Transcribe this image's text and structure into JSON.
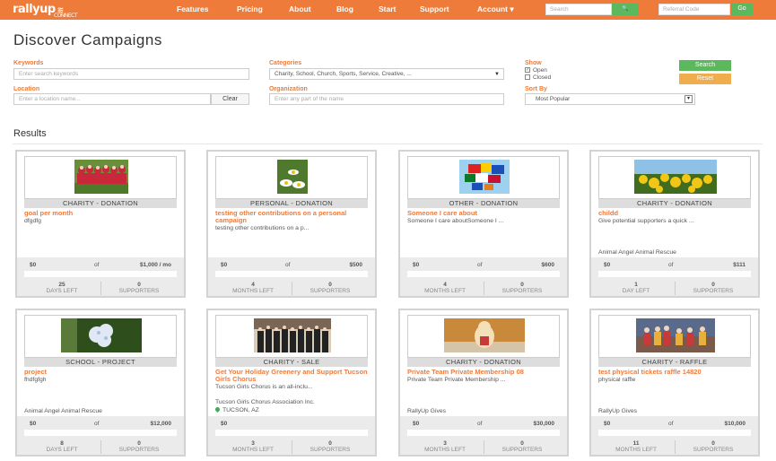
{
  "header": {
    "logo": "rallyup",
    "logo_small": "CONNECT",
    "nav": [
      "Features",
      "Pricing",
      "About",
      "Blog",
      "Start",
      "Support",
      "Account ▾"
    ],
    "search_placeholder": "Search",
    "search_button": "🔍",
    "referral_placeholder": "Referral Code",
    "go_label": "Go",
    "accent": "#ef7b3a"
  },
  "page_title": "Discover Campaigns",
  "filters": {
    "keywords_label": "Keywords",
    "keywords_placeholder": "Enter search keywords",
    "categories_label": "Categories",
    "categories_value": "Charity, School, Church, Sports, Service, Creative, ...",
    "show_label": "Show",
    "show_open": "Open",
    "show_closed": "Closed",
    "location_label": "Location",
    "location_placeholder": "Enter a location name...",
    "clear_label": "Clear",
    "organization_label": "Organization",
    "organization_placeholder": "Enter any part of the name",
    "sortby_label": "Sort By",
    "sortby_value": "Most Popular",
    "search_label": "Search",
    "reset_label": "Reset"
  },
  "results_label": "Results",
  "campaigns": [
    {
      "category": "CHARITY - DONATION",
      "title": "goal per month",
      "desc": "dfgdfg",
      "org": "",
      "loc": "",
      "raised": "$0",
      "of": "of",
      "goal": "$1,000 / mo",
      "time_num": "25",
      "time_label": "DAYS LEFT",
      "supp_num": "0",
      "supp_label": "SUPPORTERS",
      "img": "team"
    },
    {
      "category": "PERSONAL - DONATION",
      "title": "testing other contributions on a personal campaign",
      "desc": "testing other contributions on a p...",
      "org": "",
      "loc": "",
      "raised": "$0",
      "of": "of",
      "goal": "$500",
      "time_num": "4",
      "time_label": "MONTHS LEFT",
      "supp_num": "0",
      "supp_label": "SUPPORTERS",
      "img": "daisy"
    },
    {
      "category": "OTHER - DONATION",
      "title": "Someone I care about",
      "desc": "Someone I care aboutSomeone I ...",
      "org": "",
      "loc": "",
      "raised": "$0",
      "of": "of",
      "goal": "$600",
      "time_num": "4",
      "time_label": "MONTHS LEFT",
      "supp_num": "0",
      "supp_label": "SUPPORTERS",
      "img": "flags"
    },
    {
      "category": "CHARITY - DONATION",
      "title": "childd",
      "desc": "Give potential supporters a quick ...",
      "org": "Animal Angel Animal Rescue",
      "loc": "",
      "raised": "$0",
      "of": "of",
      "goal": "$111",
      "time_num": "1",
      "time_label": "DAY LEFT",
      "supp_num": "0",
      "supp_label": "SUPPORTERS",
      "img": "yellow"
    },
    {
      "category": "SCHOOL - PROJECT",
      "title": "project",
      "desc": "fhdfgfgh",
      "org": "Animal Angel Animal Rescue",
      "loc": "",
      "raised": "$0",
      "of": "of",
      "goal": "$12,000",
      "time_num": "8",
      "time_label": "DAYS LEFT",
      "supp_num": "0",
      "supp_label": "SUPPORTERS",
      "img": "hydrangea"
    },
    {
      "category": "CHARITY - SALE",
      "title": "Get Your Holiday Greenery and Support Tucson Girls Chorus",
      "desc": "Tucson Girls Chorus is an all-inclu...",
      "org": "Tucson Girls Chorus Association Inc.",
      "loc": "TUCSON, AZ",
      "raised": "$0",
      "of": "",
      "goal": "",
      "time_num": "3",
      "time_label": "MONTHS LEFT",
      "supp_num": "0",
      "supp_label": "SUPPORTERS",
      "img": "chorus"
    },
    {
      "category": "CHARITY - DONATION",
      "title": "Private Team Private Membership 08",
      "desc": "Private Team Private Membership ...",
      "org": "RallyUp Gives",
      "loc": "",
      "raised": "$0",
      "of": "of",
      "goal": "$30,000",
      "time_num": "3",
      "time_label": "MONTHS LEFT",
      "supp_num": "0",
      "supp_label": "SUPPORTERS",
      "img": "dog"
    },
    {
      "category": "CHARITY - RAFFLE",
      "title": "test physical tickets raffle 14820",
      "desc": "physical raffle",
      "org": "RallyUp Gives",
      "loc": "",
      "raised": "$0",
      "of": "of",
      "goal": "$10,000",
      "time_num": "11",
      "time_label": "MONTHS LEFT",
      "supp_num": "0",
      "supp_label": "SUPPORTERS",
      "img": "kids"
    }
  ]
}
